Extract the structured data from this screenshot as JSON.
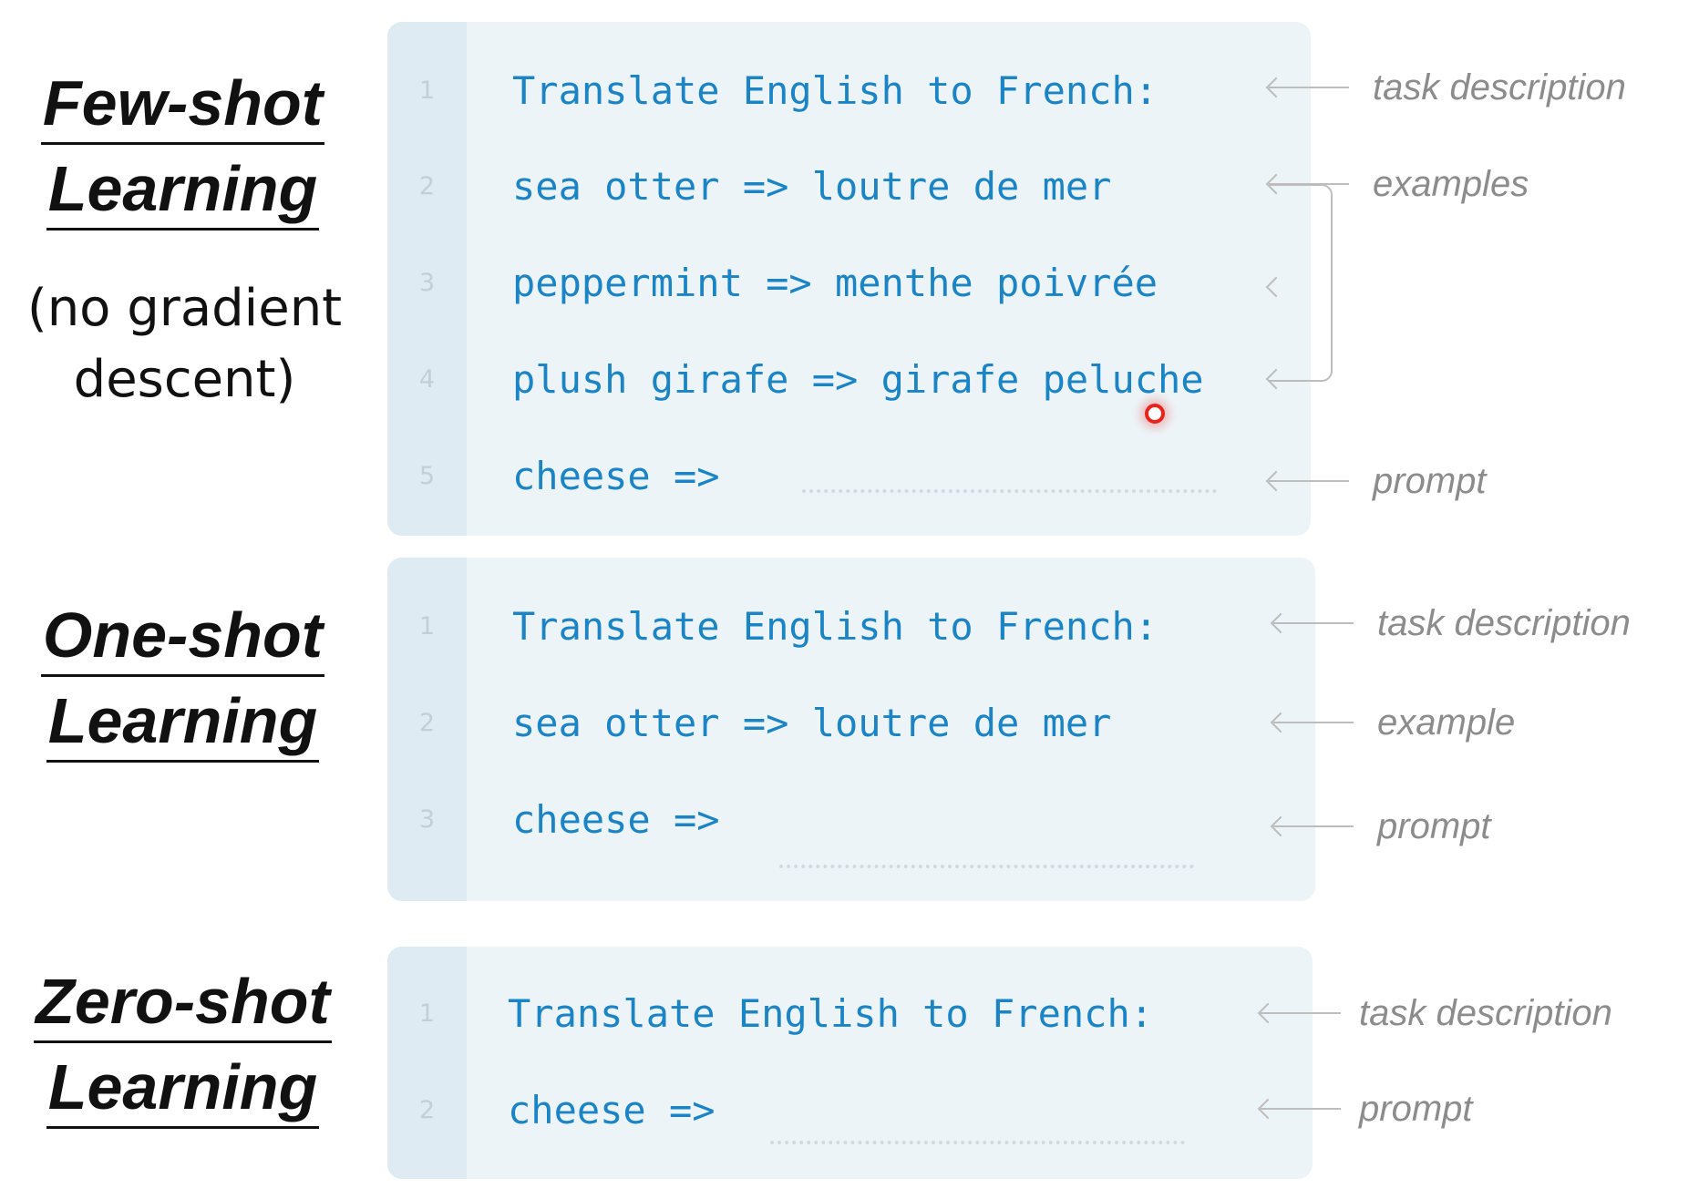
{
  "few_shot": {
    "title_line1": "Few-shot",
    "title_line2": "Learning",
    "note_line1": "(no gradient",
    "note_line2": "descent)",
    "lines": [
      {
        "num": "1",
        "text": "Translate English to French:"
      },
      {
        "num": "2",
        "text": "sea otter => loutre de mer"
      },
      {
        "num": "3",
        "text": "peppermint => menthe poivrée"
      },
      {
        "num": "4",
        "text": "plush girafe => girafe peluche"
      },
      {
        "num": "5",
        "text": "cheese =>"
      }
    ],
    "annotations": {
      "task": "task description",
      "examples": "examples",
      "prompt": "prompt"
    }
  },
  "one_shot": {
    "title_line1": "One-shot",
    "title_line2": "Learning",
    "lines": [
      {
        "num": "1",
        "text": "Translate English to French:"
      },
      {
        "num": "2",
        "text": "sea otter => loutre de mer"
      },
      {
        "num": "3",
        "text": "cheese =>"
      }
    ],
    "annotations": {
      "task": "task description",
      "example": "example",
      "prompt": "prompt"
    }
  },
  "zero_shot": {
    "title_line1": "Zero-shot",
    "title_line2": "Learning",
    "lines": [
      {
        "num": "1",
        "text": "Translate English to French:"
      },
      {
        "num": "2",
        "text": "cheese =>"
      }
    ],
    "annotations": {
      "task": "task description",
      "prompt": "prompt"
    }
  },
  "colors": {
    "code": "#1a84c4",
    "panel": "#edf4f8",
    "gutter": "#deebf3",
    "annotation": "#8c8c8c",
    "cursor": "#e8231d"
  },
  "icons": [
    "left-arrow-icon",
    "cursor-dot-icon"
  ]
}
